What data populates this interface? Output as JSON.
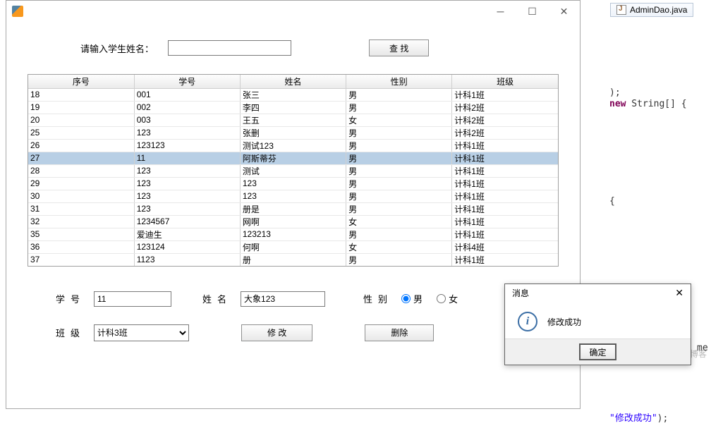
{
  "background": {
    "tab_file": "AdminDao.java",
    "code_line1": ");",
    "code_line2_kw": "new",
    "code_line2_rest": " String[] {",
    "code_line3": "{",
    "code_line4_text": "\"修改成功\"",
    "code_line4_tail": ");",
    "side_text": "me",
    "watermark": "博客"
  },
  "window": {
    "search_label": "请输入学生姓名：",
    "search_value": "",
    "search_button": "查 找",
    "columns": [
      "序号",
      "学号",
      "姓名",
      "性别",
      "班级"
    ],
    "rows": [
      {
        "no": "18",
        "sid": "001",
        "name": "张三",
        "sex": "男",
        "cls": "计科1班",
        "sel": false
      },
      {
        "no": "19",
        "sid": "002",
        "name": "李四",
        "sex": "男",
        "cls": "计科2班",
        "sel": false
      },
      {
        "no": "20",
        "sid": "003",
        "name": "王五",
        "sex": "女",
        "cls": "计科2班",
        "sel": false
      },
      {
        "no": "25",
        "sid": "123",
        "name": "张删",
        "sex": "男",
        "cls": "计科2班",
        "sel": false
      },
      {
        "no": "26",
        "sid": "123123",
        "name": "测试123",
        "sex": "男",
        "cls": "计科1班",
        "sel": false
      },
      {
        "no": "27",
        "sid": "11",
        "name": "阿斯蒂芬",
        "sex": "男",
        "cls": "计科1班",
        "sel": true
      },
      {
        "no": "28",
        "sid": "123",
        "name": "测试",
        "sex": "男",
        "cls": "计科1班",
        "sel": false
      },
      {
        "no": "29",
        "sid": "123",
        "name": "123",
        "sex": "男",
        "cls": "计科1班",
        "sel": false
      },
      {
        "no": "30",
        "sid": "123",
        "name": "123",
        "sex": "男",
        "cls": "计科1班",
        "sel": false
      },
      {
        "no": "31",
        "sid": "123",
        "name": "册是",
        "sex": "男",
        "cls": "计科1班",
        "sel": false
      },
      {
        "no": "32",
        "sid": "1234567",
        "name": "网啊",
        "sex": "女",
        "cls": "计科1班",
        "sel": false
      },
      {
        "no": "35",
        "sid": "爱迪生",
        "name": "123213",
        "sex": "男",
        "cls": "计科1班",
        "sel": false
      },
      {
        "no": "36",
        "sid": "123124",
        "name": "何啊",
        "sex": "女",
        "cls": "计科4班",
        "sel": false
      },
      {
        "no": "37",
        "sid": "1123",
        "name": "册",
        "sex": "男",
        "cls": "计科1班",
        "sel": false
      }
    ],
    "form": {
      "sid_label": "学号",
      "sid_value": "11",
      "name_label": "姓名",
      "name_value": "大象123",
      "sex_label": "性别",
      "male": "男",
      "female": "女",
      "sex_value": "男",
      "class_label": "班级",
      "class_value": "计科3班",
      "modify_button": "修 改",
      "delete_button": "删除"
    }
  },
  "dialog": {
    "title": "消息",
    "message": "修改成功",
    "ok": "确定"
  }
}
